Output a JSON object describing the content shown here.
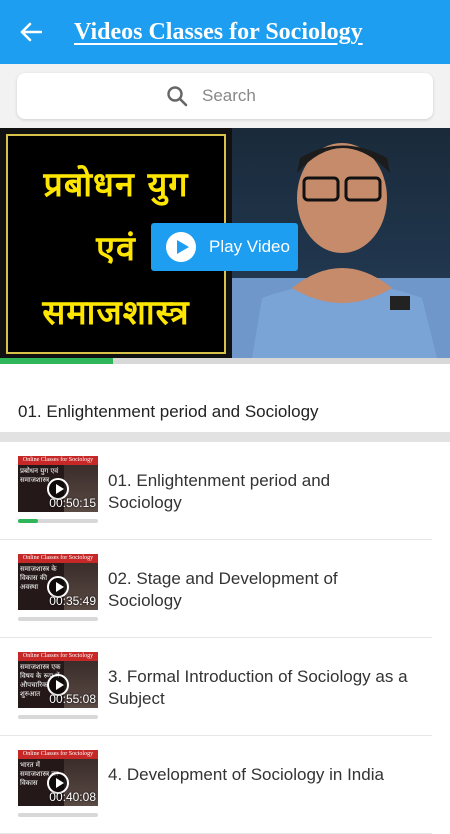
{
  "appbar": {
    "title": "Videos Classes for Sociology"
  },
  "search": {
    "placeholder": "Search"
  },
  "player": {
    "thumb_lines": [
      "प्रबोधन युग",
      "एवं",
      "समाजशास्त्र"
    ],
    "play_label": "Play Video",
    "progress": 0.25
  },
  "now_playing": {
    "title": "01. Enlightenment period and Sociology"
  },
  "thumb_banner": "Online Classes for Sociology",
  "videos": [
    {
      "title": "01. Enlightenment period and Sociology",
      "duration": "00:50:15",
      "thumb_text": "प्रबोधन युग एवं समाजशास्त्र",
      "progress": 0.25
    },
    {
      "title": "02. Stage and Development of Sociology",
      "duration": "00:35:49",
      "thumb_text": "समाजशास्त्र के विकास की अवस्था",
      "progress": 0
    },
    {
      "title": "3. Formal Introduction of Sociology as a Subject",
      "duration": "00:55:08",
      "thumb_text": "समाजशास्त्र एक विषय के रूप में औपचारिक शुरुआत",
      "progress": 0
    },
    {
      "title": "4. Development of Sociology in India",
      "duration": "00:40:08",
      "thumb_text": "भारत में समाजशास्त्र का विकास",
      "progress": 0
    }
  ],
  "colors": {
    "accent": "#1e9ef0",
    "progress": "#2fb55a"
  }
}
